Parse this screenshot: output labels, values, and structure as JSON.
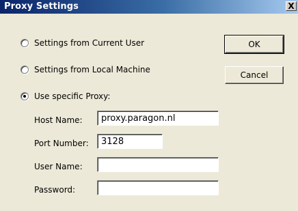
{
  "window": {
    "title": "Proxy Settings",
    "close_glyph": "X"
  },
  "radios": [
    {
      "label": "Settings from Current User",
      "checked": false
    },
    {
      "label": "Settings from Local Machine",
      "checked": false
    },
    {
      "label": "Use specific Proxy:",
      "checked": true
    }
  ],
  "buttons": {
    "ok": "OK",
    "cancel": "Cancel"
  },
  "fields": {
    "host": {
      "label": "Host Name:",
      "value": "proxy.paragon.nl"
    },
    "port": {
      "label": "Port Number:",
      "value": "3128"
    },
    "user": {
      "label": "User Name:",
      "value": ""
    },
    "password": {
      "label": "Password:",
      "value": ""
    }
  }
}
